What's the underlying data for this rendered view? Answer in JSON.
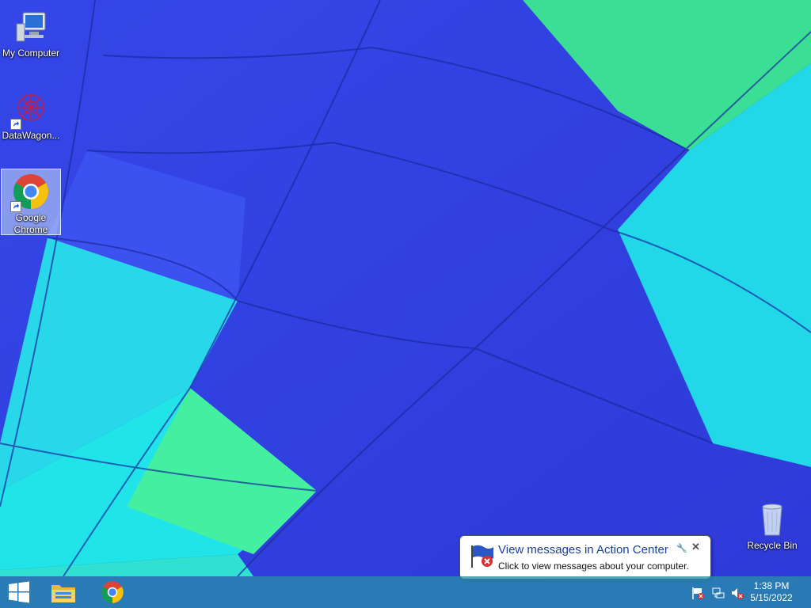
{
  "desktop": {
    "icons": [
      {
        "label": "My Computer"
      },
      {
        "label": "DataWagon..."
      },
      {
        "label": "Google Chrome"
      },
      {
        "label": "Recycle Bin"
      }
    ]
  },
  "notification": {
    "title": "View messages in Action Center",
    "body": "Click to view messages about your computer."
  },
  "taskbar": {
    "pinned": [
      "file-explorer-icon",
      "chrome-icon"
    ],
    "clock": {
      "time": "1:38 PM",
      "date": "5/15/2022"
    },
    "tray": [
      "action-center-flag-icon",
      "network-icon",
      "volume-muted-icon"
    ]
  },
  "colors": {
    "accent": "#1c3fa0",
    "taskbar": "#288caa",
    "wallpaper_blue": "#3a4ef0",
    "wallpaper_cyan": "#1ee6e6",
    "wallpaper_green": "#3cf0a0"
  }
}
